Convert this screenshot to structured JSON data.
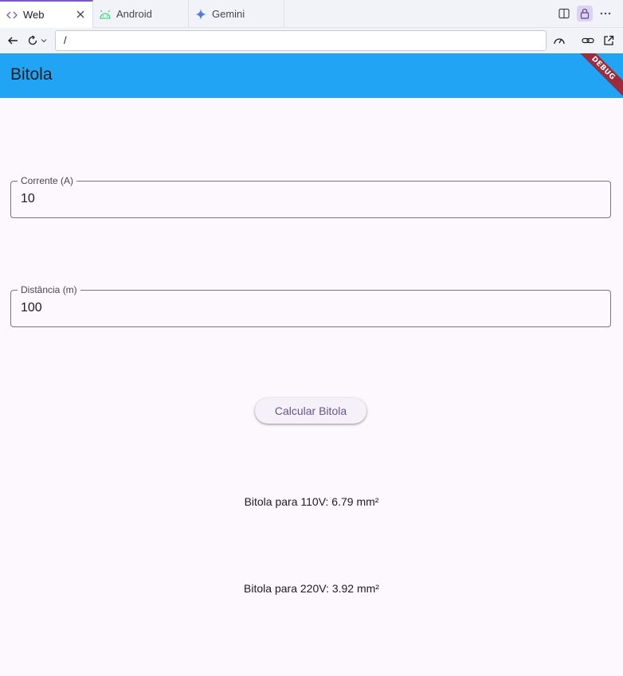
{
  "browser": {
    "tabs": [
      {
        "label": "Web",
        "icon": "code-icon"
      },
      {
        "label": "Android",
        "icon": "android-icon"
      },
      {
        "label": "Gemini",
        "icon": "gemini-sparkle-icon"
      }
    ],
    "url": "/"
  },
  "app": {
    "title": "Bitola",
    "debug_banner": "DEBUG",
    "current_field": {
      "label": "Corrente (A)",
      "value": "10"
    },
    "distance_field": {
      "label": "Distância (m)",
      "value": "100"
    },
    "calculate_button": "Calcular Bitola",
    "result_110": "Bitola para 110V: 6.79 mm²",
    "result_220": "Bitola para 220V: 3.92 mm²"
  },
  "colors": {
    "app_bar": "#21a4f3",
    "background": "#fdf7fe",
    "button_text": "#65558f",
    "debug_banner": "#9c2b3c"
  }
}
